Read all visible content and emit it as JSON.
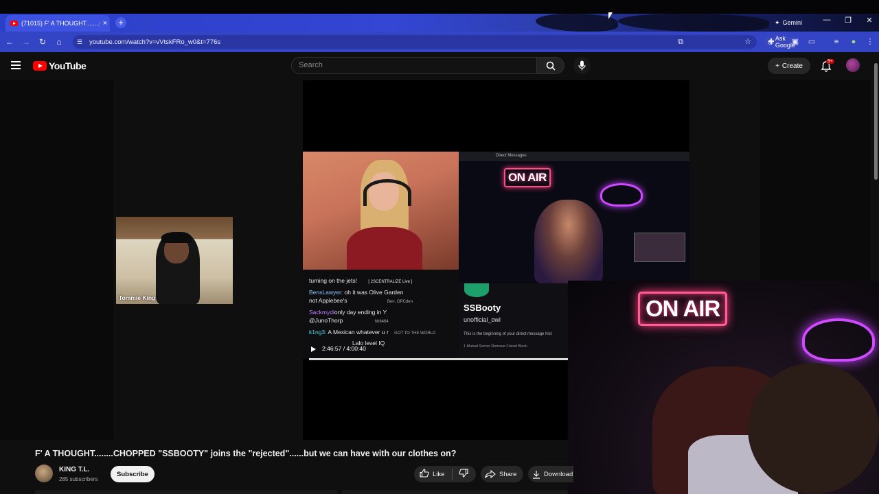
{
  "browser": {
    "tab_title": "(71015) F' A THOUGHT........CH",
    "tab_close": "×",
    "new_tab": "+",
    "gemini_label": "Gemini",
    "url": "youtube.com/watch?v=vVtskFRo_w0&t=776s",
    "ask_google": "Ask Google",
    "window_min": "—",
    "window_restore": "❐",
    "window_close": "✕"
  },
  "youtube": {
    "logo_text": "YouTube",
    "search_placeholder": "Search",
    "create_label": "Create",
    "notif_badge": "9+"
  },
  "player": {
    "chat_lines": [
      {
        "user": "",
        "text": "turning on the jets!",
        "extra": "[ 2SCENTRALIZE Live ]"
      },
      {
        "user": "BensLawyer:",
        "text": " oh it was Olive Garden"
      },
      {
        "user": "",
        "text": "not Applebee's",
        "extra": "Ben, OPCden"
      },
      {
        "user": "Sackmydi",
        "text": "only day ending in Y"
      },
      {
        "user": "@JunoThorp",
        "text": "",
        "extra": "hh6464"
      },
      {
        "user": "k1ng3:",
        "text": " A Mexican whatever u r",
        "extra": "GOT TO THE WORLD"
      },
      {
        "user": "",
        "text": "Lalo level IQ"
      }
    ],
    "dm_header": "Direct Messages",
    "dm_name": "SSBooty",
    "dm_handle": "unofficial_owl",
    "dm_note": "This is the beginning of your direct message hist",
    "dm_sub": "1 Mutual Server    Remove Friend    Block",
    "onair_small": "ON AIR",
    "timecode": "2:46:57 / 4:00:40",
    "webcam_label": "Tommie King",
    "onair_big": "ON AIR"
  },
  "video": {
    "title": "F' A THOUGHT........CHOPPED \"SSBOOTY\" joins the \"rejected\"......but we can have with our clothes on?",
    "channel_name": "KING T.L.",
    "subscribers": "285 subscribers",
    "subscribe_label": "Subscribe",
    "like_label": "Like",
    "share_label": "Share",
    "download_label": "Download"
  }
}
